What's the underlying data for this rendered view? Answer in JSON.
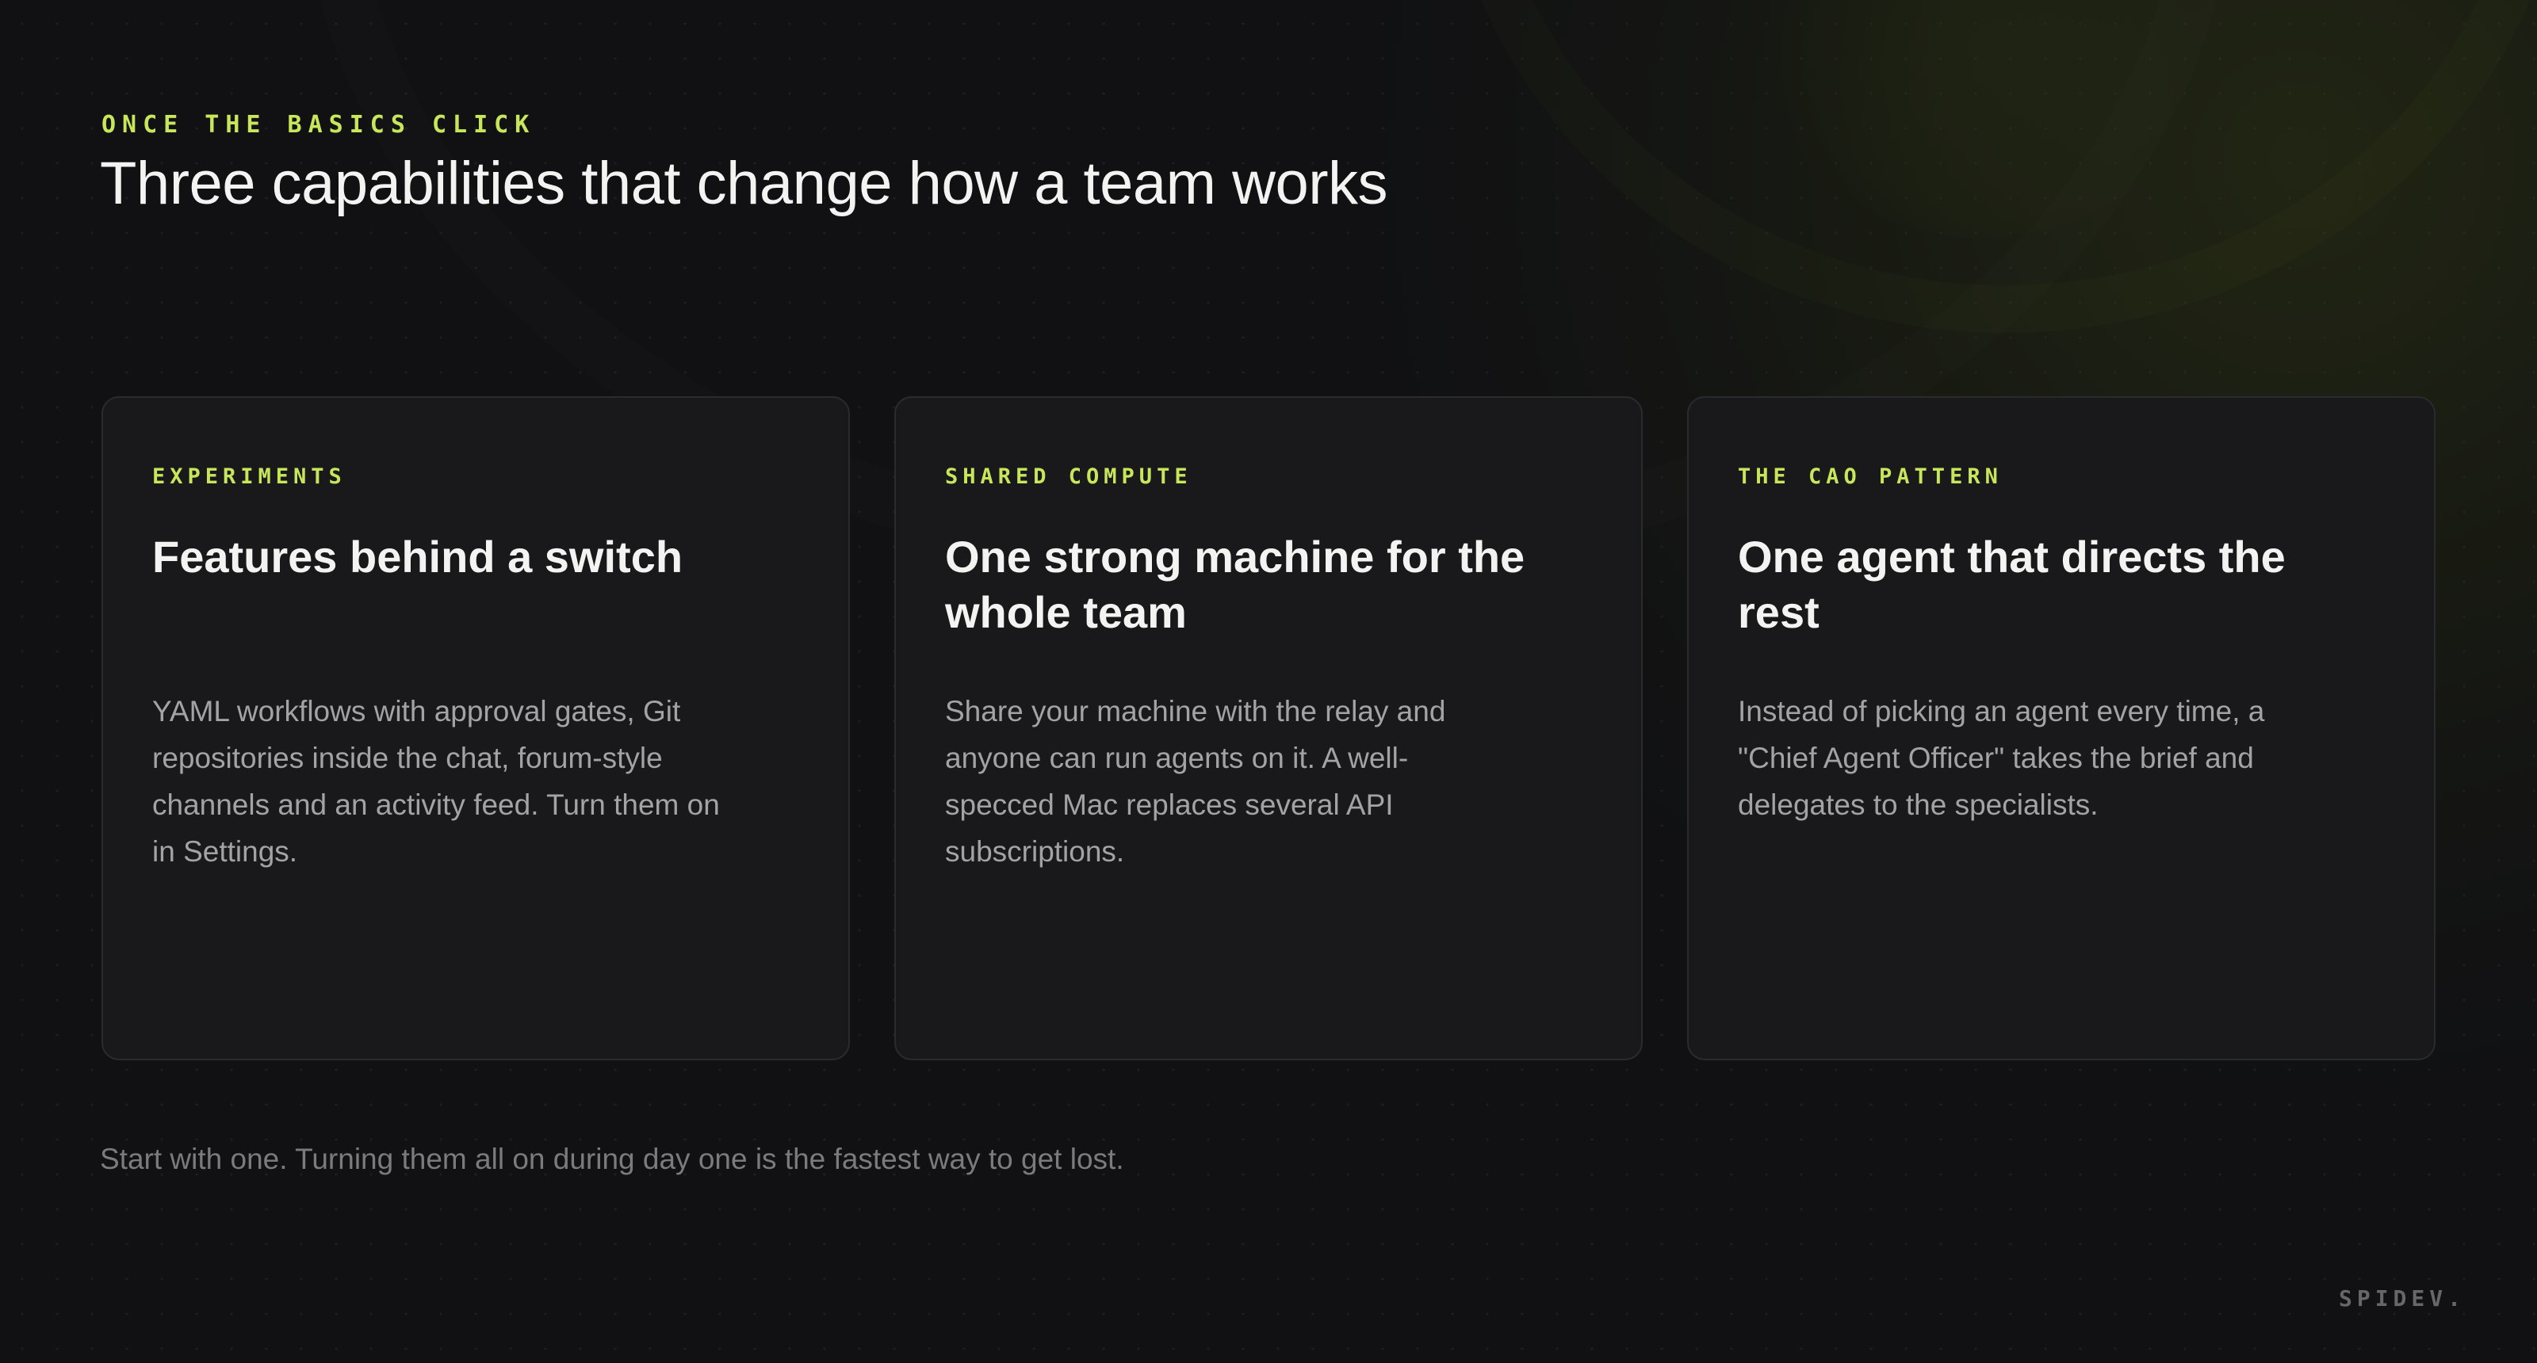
{
  "slide": {
    "eyebrow": "ONCE THE BASICS CLICK",
    "title": "Three capabilities that change how a team works",
    "cards": [
      {
        "eyebrow": "EXPERIMENTS",
        "title": "Features behind a switch",
        "body": "YAML workflows with approval gates, Git repositories inside the chat, forum-style channels and an activity feed. Turn them on in Settings."
      },
      {
        "eyebrow": "SHARED COMPUTE",
        "title": "One strong machine for the whole team",
        "body": "Share your machine with the relay and anyone can run agents on it. A well-specced Mac replaces several API subscriptions."
      },
      {
        "eyebrow": "THE CAO PATTERN",
        "title": "One agent that directs the rest",
        "body": "Instead of picking an agent every time, a \"Chief Agent Officer\" takes the brief and delegates to the specialists."
      }
    ],
    "footnote": "Start with one. Turning them all on during day one is the fastest way to get lost.",
    "brand": "SPIDEV."
  },
  "colors": {
    "background": "#111114",
    "accent": "#c8e65a",
    "card_background": "#19191c",
    "card_border": "#2a2a2f",
    "title_text": "#f3f3f1",
    "body_text": "#a3a3a6",
    "muted_text": "#7b7b7f"
  }
}
